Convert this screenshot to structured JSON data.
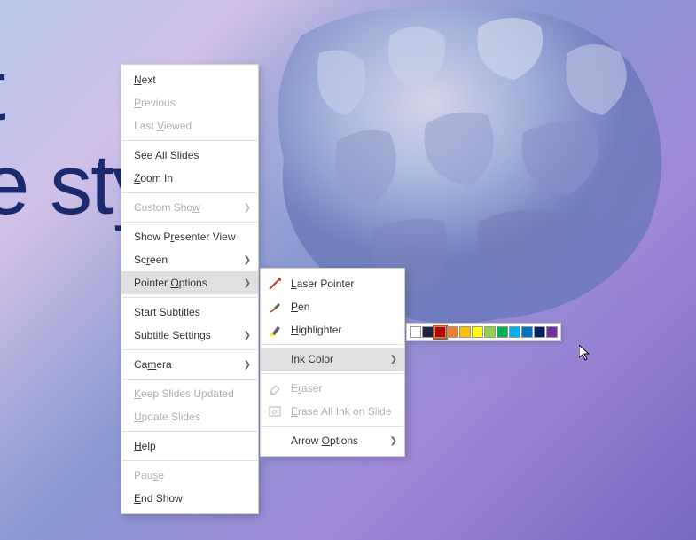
{
  "background": {
    "partial_text_1": "t",
    "partial_text_2": "e sty"
  },
  "menu1": {
    "items": [
      {
        "pre": "",
        "u": "N",
        "post": "ext",
        "disabled": false,
        "sep_after": false,
        "arrow": false
      },
      {
        "pre": "",
        "u": "P",
        "post": "revious",
        "disabled": true,
        "sep_after": false,
        "arrow": false
      },
      {
        "pre": "Last ",
        "u": "V",
        "post": "iewed",
        "disabled": true,
        "sep_after": true,
        "arrow": false
      },
      {
        "pre": "See ",
        "u": "A",
        "post": "ll Slides",
        "disabled": false,
        "sep_after": false,
        "arrow": false
      },
      {
        "pre": "",
        "u": "Z",
        "post": "oom In",
        "disabled": false,
        "sep_after": true,
        "arrow": false
      },
      {
        "pre": "Custom Sho",
        "u": "w",
        "post": "",
        "disabled": true,
        "sep_after": true,
        "arrow": true
      },
      {
        "pre": "Show P",
        "u": "r",
        "post": "esenter View",
        "disabled": false,
        "sep_after": false,
        "arrow": false
      },
      {
        "pre": "Sc",
        "u": "r",
        "post": "een",
        "disabled": false,
        "sep_after": false,
        "arrow": true
      },
      {
        "pre": "Pointer ",
        "u": "O",
        "post": "ptions",
        "disabled": false,
        "sep_after": true,
        "arrow": true,
        "highlight": true
      },
      {
        "pre": "Start Su",
        "u": "b",
        "post": "titles",
        "disabled": false,
        "sep_after": false,
        "arrow": false
      },
      {
        "pre": "Subtitle Se",
        "u": "t",
        "post": "tings",
        "disabled": false,
        "sep_after": true,
        "arrow": true
      },
      {
        "pre": "Ca",
        "u": "m",
        "post": "era",
        "disabled": false,
        "sep_after": true,
        "arrow": true
      },
      {
        "pre": "",
        "u": "K",
        "post": "eep Slides Updated",
        "disabled": true,
        "sep_after": false,
        "arrow": false
      },
      {
        "pre": "",
        "u": "U",
        "post": "pdate Slides",
        "disabled": true,
        "sep_after": true,
        "arrow": false
      },
      {
        "pre": "",
        "u": "H",
        "post": "elp",
        "disabled": false,
        "sep_after": true,
        "arrow": false
      },
      {
        "pre": "Pau",
        "u": "s",
        "post": "e",
        "disabled": true,
        "sep_after": false,
        "arrow": false
      },
      {
        "pre": "",
        "u": "E",
        "post": "nd Show",
        "disabled": false,
        "sep_after": false,
        "arrow": false
      }
    ]
  },
  "menu2": {
    "items": [
      {
        "pre": "",
        "u": "L",
        "post": "aser Pointer",
        "disabled": false,
        "sep_after": false,
        "arrow": false,
        "icon": "laser"
      },
      {
        "pre": "",
        "u": "P",
        "post": "en",
        "disabled": false,
        "sep_after": false,
        "arrow": false,
        "icon": "pen"
      },
      {
        "pre": "",
        "u": "H",
        "post": "ighlighter",
        "disabled": false,
        "sep_after": true,
        "arrow": false,
        "icon": "highlighter"
      },
      {
        "pre": "Ink ",
        "u": "C",
        "post": "olor",
        "disabled": false,
        "sep_after": true,
        "arrow": true,
        "icon": "",
        "highlight": true
      },
      {
        "pre": "E",
        "u": "r",
        "post": "aser",
        "disabled": true,
        "sep_after": false,
        "arrow": false,
        "icon": "eraser"
      },
      {
        "pre": "",
        "u": "E",
        "post": "rase All Ink on Slide",
        "disabled": true,
        "sep_after": true,
        "arrow": false,
        "icon": "erase-all"
      },
      {
        "pre": "Arrow ",
        "u": "O",
        "post": "ptions",
        "disabled": false,
        "sep_after": false,
        "arrow": true,
        "icon": ""
      }
    ]
  },
  "palette": {
    "colors": [
      "#ffffff",
      "#1f2340",
      "#c00000",
      "#ed7d31",
      "#ffc000",
      "#ffff00",
      "#92d050",
      "#00b050",
      "#00b0f0",
      "#0070c0",
      "#002060",
      "#7030a0"
    ],
    "selected_index": 2
  }
}
